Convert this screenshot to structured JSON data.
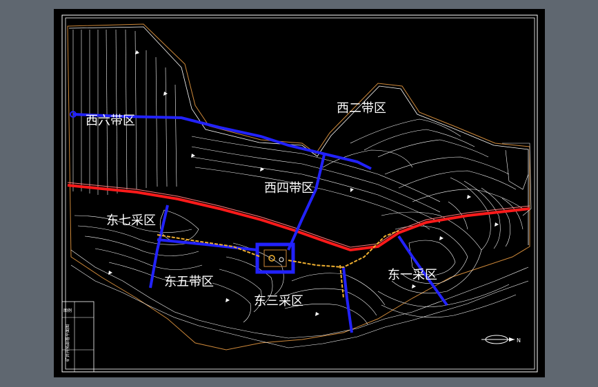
{
  "drawing": {
    "zones": [
      {
        "id": "west-six",
        "label": "西六带区"
      },
      {
        "id": "west-two",
        "label": "西二带区"
      },
      {
        "id": "west-four",
        "label": "西四带区"
      },
      {
        "id": "east-seven",
        "label": "东七采区"
      },
      {
        "id": "east-five",
        "label": "东五带区"
      },
      {
        "id": "east-three",
        "label": "东三采区"
      },
      {
        "id": "east-one",
        "label": "东一采区"
      }
    ],
    "title_block": {
      "header": "图例",
      "caption": "矿井开拓部署平面图"
    },
    "north_arrow": {
      "label": "N"
    },
    "colors": {
      "background": "#000000",
      "frame": "#ffffff",
      "contour": "#ffffff",
      "boundary": "#d08a3a",
      "main_roadway": "#ff1a1a",
      "haulage_roadway": "#2222ff",
      "conveyor_roadway": "#f0b030"
    }
  }
}
